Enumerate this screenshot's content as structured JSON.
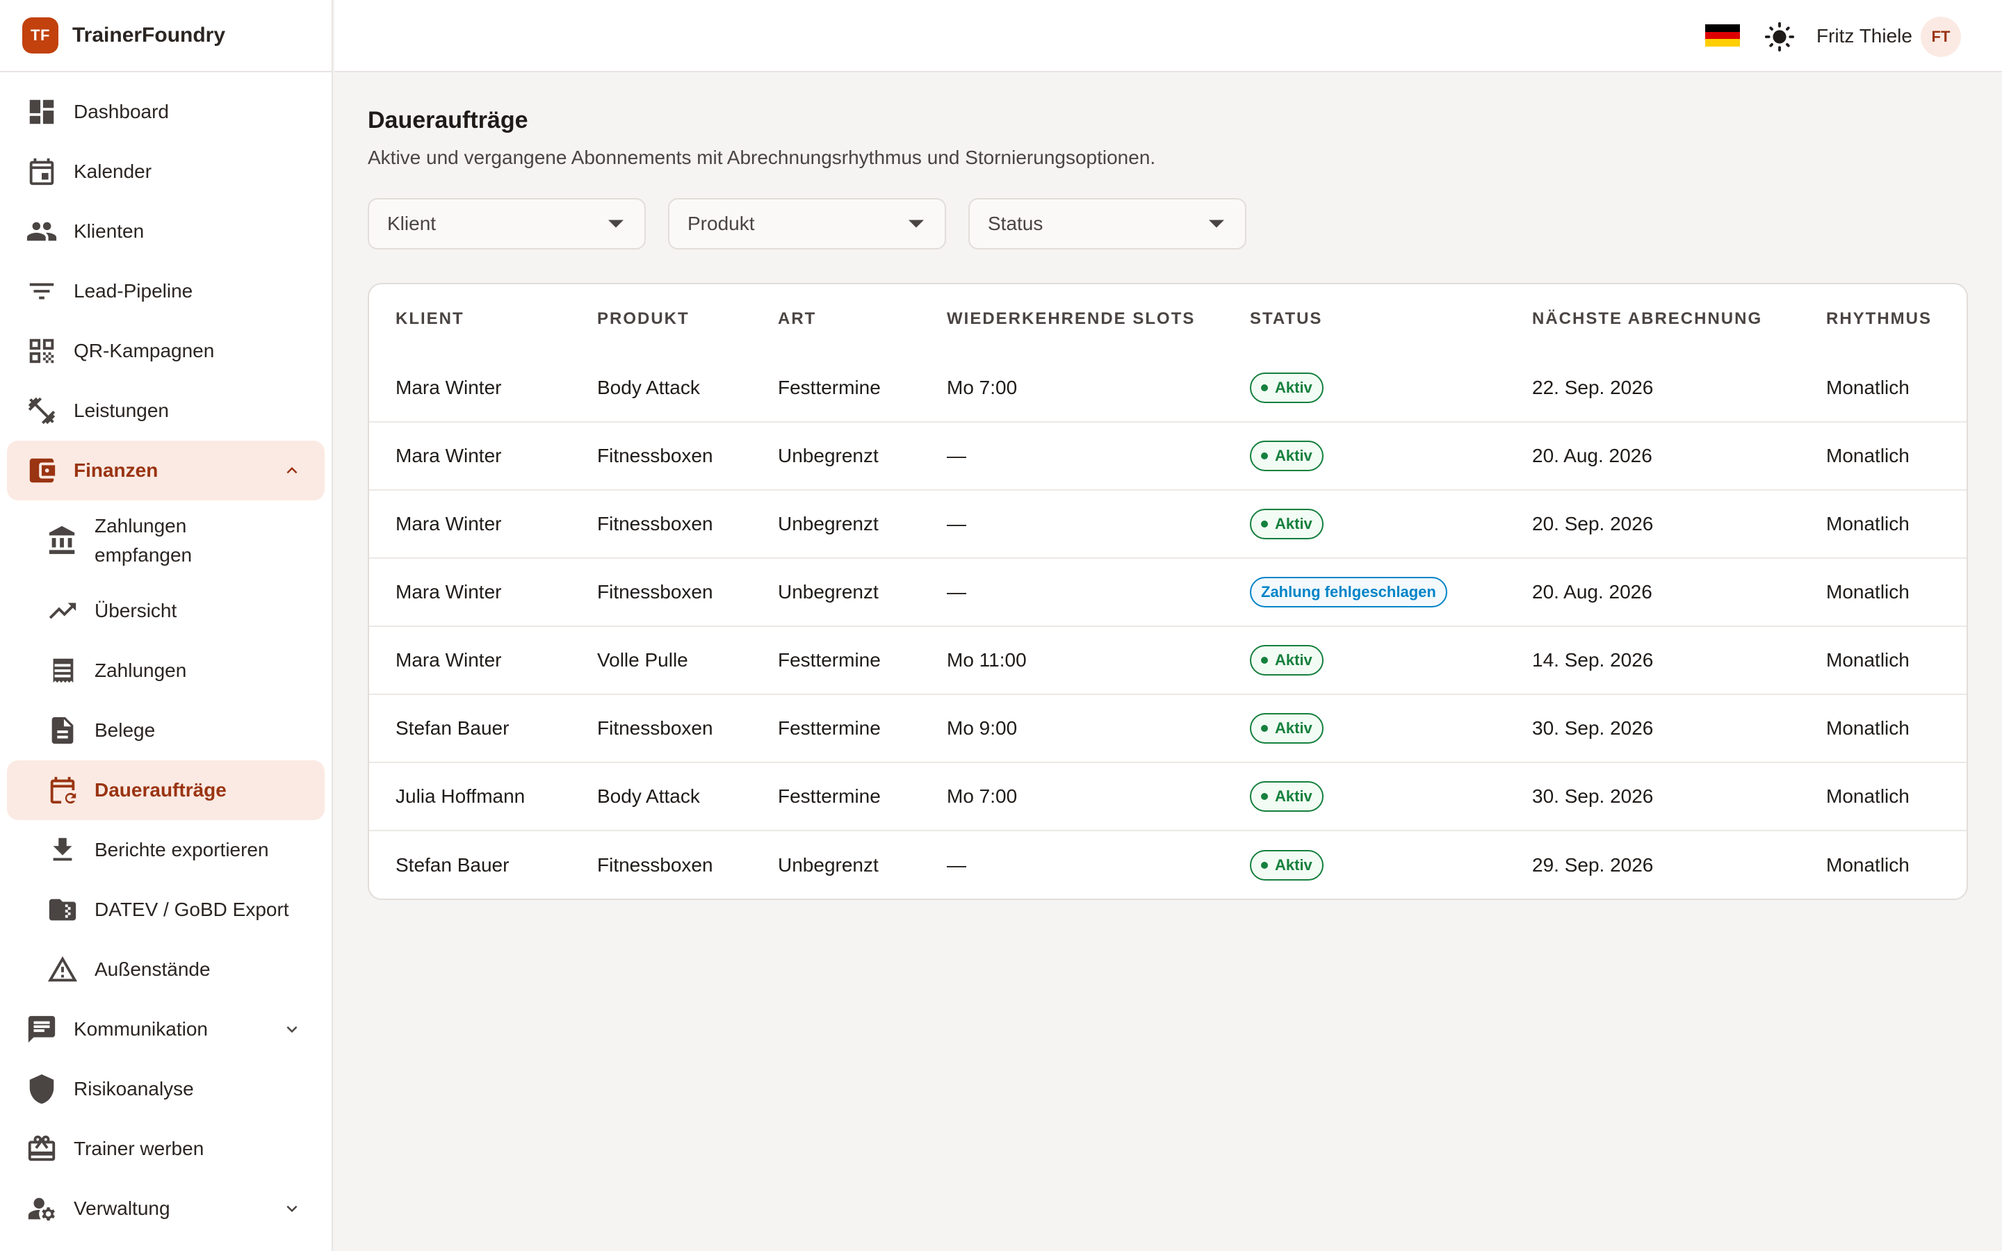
{
  "brand": {
    "logo_text": "TF",
    "name": "TrainerFoundry",
    "accent": "#c2410c"
  },
  "topbar": {
    "language_flag": "germany-flag",
    "user_name": "Fritz Thiele",
    "avatar_initials": "FT"
  },
  "sidebar": {
    "items": [
      {
        "label": "Dashboard",
        "icon": "dashboard-icon"
      },
      {
        "label": "Kalender",
        "icon": "calendar-icon"
      },
      {
        "label": "Klienten",
        "icon": "people-icon"
      },
      {
        "label": "Lead-Pipeline",
        "icon": "filter-icon"
      },
      {
        "label": "QR-Kampagnen",
        "icon": "qr-code-icon"
      },
      {
        "label": "Leistungen",
        "icon": "dumbbell-icon"
      },
      {
        "label": "Finanzen",
        "icon": "wallet-icon"
      }
    ],
    "finance_sub": [
      {
        "label": "Zahlungen empfangen",
        "icon": "bank-icon"
      },
      {
        "label": "Übersicht",
        "icon": "trending-up-icon"
      },
      {
        "label": "Zahlungen",
        "icon": "receipt-icon"
      },
      {
        "label": "Belege",
        "icon": "document-icon"
      },
      {
        "label": "Daueraufträge",
        "icon": "calendar-repeat-icon"
      },
      {
        "label": "Berichte exportieren",
        "icon": "download-icon"
      },
      {
        "label": "DATEV / GoBD Export",
        "icon": "folder-zip-icon"
      },
      {
        "label": "Außenstände",
        "icon": "warning-icon"
      }
    ],
    "bottom_items": [
      {
        "label": "Kommunikation",
        "icon": "message-icon"
      },
      {
        "label": "Risikoanalyse",
        "icon": "shield-icon"
      },
      {
        "label": "Trainer werben",
        "icon": "gift-icon"
      },
      {
        "label": "Verwaltung",
        "icon": "user-settings-icon"
      }
    ]
  },
  "page": {
    "title": "Daueraufträge",
    "subtitle": "Aktive und vergangene Abonnements mit Abrechnungsrhythmus und Stornierungsoptionen."
  },
  "filters": {
    "client": "Klient",
    "product": "Produkt",
    "status": "Status"
  },
  "table": {
    "headers": [
      "KLIENT",
      "PRODUKT",
      "ART",
      "WIEDERKEHRENDE SLOTS",
      "STATUS",
      "NÄCHSTE ABRECHNUNG",
      "RHYTHMUS"
    ],
    "rows": [
      {
        "client": "Mara Winter",
        "product": "Body Attack",
        "type": "Festtermine",
        "slots": "Mo 7:00",
        "status": "Aktiv",
        "status_kind": "ok",
        "next_billing": "22. Sep. 2026",
        "rhythm": "Monatlich"
      },
      {
        "client": "Mara Winter",
        "product": "Fitnessboxen",
        "type": "Unbegrenzt",
        "slots": "—",
        "status": "Aktiv",
        "status_kind": "ok",
        "next_billing": "20. Aug. 2026",
        "rhythm": "Monatlich"
      },
      {
        "client": "Mara Winter",
        "product": "Fitnessboxen",
        "type": "Unbegrenzt",
        "slots": "—",
        "status": "Aktiv",
        "status_kind": "ok",
        "next_billing": "20. Sep. 2026",
        "rhythm": "Monatlich"
      },
      {
        "client": "Mara Winter",
        "product": "Fitnessboxen",
        "type": "Unbegrenzt",
        "slots": "—",
        "status": "Zahlung fehlgeschlagen",
        "status_kind": "fail",
        "next_billing": "20. Aug. 2026",
        "rhythm": "Monatlich"
      },
      {
        "client": "Mara Winter",
        "product": "Volle Pulle",
        "type": "Festtermine",
        "slots": "Mo 11:00",
        "status": "Aktiv",
        "status_kind": "ok",
        "next_billing": "14. Sep. 2026",
        "rhythm": "Monatlich"
      },
      {
        "client": "Stefan Bauer",
        "product": "Fitnessboxen",
        "type": "Festtermine",
        "slots": "Mo 9:00",
        "status": "Aktiv",
        "status_kind": "ok",
        "next_billing": "30. Sep. 2026",
        "rhythm": "Monatlich"
      },
      {
        "client": "Julia Hoffmann",
        "product": "Body Attack",
        "type": "Festtermine",
        "slots": "Mo 7:00",
        "status": "Aktiv",
        "status_kind": "ok",
        "next_billing": "30. Sep. 2026",
        "rhythm": "Monatlich"
      },
      {
        "client": "Stefan Bauer",
        "product": "Fitnessboxen",
        "type": "Unbegrenzt",
        "slots": "—",
        "status": "Aktiv",
        "status_kind": "ok",
        "next_billing": "29. Sep. 2026",
        "rhythm": "Monatlich"
      }
    ]
  }
}
